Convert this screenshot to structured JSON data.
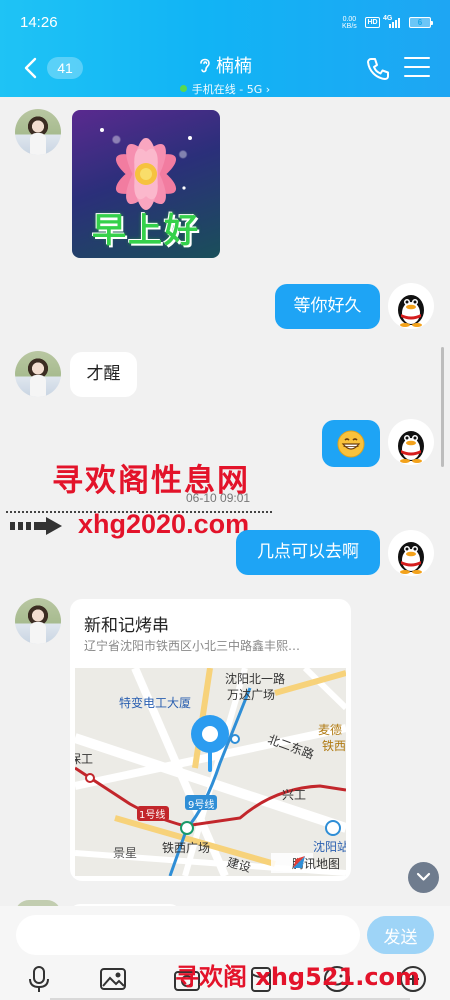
{
  "status_bar": {
    "time": "14:26",
    "net_speed_value": "0.00",
    "net_speed_unit": "KB/s",
    "hd_badge": "HD",
    "network_type": "4G",
    "battery_level": "6"
  },
  "header": {
    "unread_count": "41",
    "contact_name": "楠楠",
    "contact_status": "手机在线 - 5G",
    "status_chevron": "›"
  },
  "messages": {
    "greeting_sticker_text": "早上好",
    "sent_text_1": "等你好久",
    "received_text_1": "才醒",
    "sent_text_2": "几点可以去啊"
  },
  "watermarks": {
    "site_name": "寻欢阁性息网",
    "site_url": "xhg2020.com",
    "bottom_watermark": "寻欢阁 xhg521.com"
  },
  "timestamp": "06-10 09:01",
  "location_card": {
    "title": "新和记烤串",
    "address": "辽宁省沈阳市铁西区小北三中路鑫丰熙…",
    "map_provider": "腾讯地图",
    "map_labels": {
      "tebian": "特变电工大厦",
      "beiyilu": "沈阳北一路",
      "wanda": "万达广场",
      "beierdong": "北二东路",
      "maide": "麦德",
      "tiexi_suffix": "铁西",
      "baogong": "保工",
      "xinggong": "兴工",
      "line1": "1号线",
      "line9": "9号线",
      "tiexi_square": "铁西广场",
      "jingxing": "景星",
      "jianshe": "建设",
      "shenyang_station": "沈阳站"
    }
  },
  "input": {
    "placeholder": "",
    "value": "",
    "send_label": "发送"
  },
  "colors": {
    "header_gradient_start": "#1fc3f5",
    "header_gradient_end": "#1ea6f3",
    "outgoing_bubble": "#1ea4f5",
    "send_button": "#9ed4f7",
    "watermark_red": "#e3132a"
  },
  "icons": [
    "back-arrow-icon",
    "ear-icon",
    "phone-icon",
    "menu-icon",
    "location-pin-icon",
    "qq-penguin-icon",
    "grin-emoji-icon",
    "chevron-down-icon",
    "microphone-icon",
    "image-icon",
    "camera-icon",
    "red-packet-icon",
    "emoji-icon",
    "plus-icon"
  ]
}
